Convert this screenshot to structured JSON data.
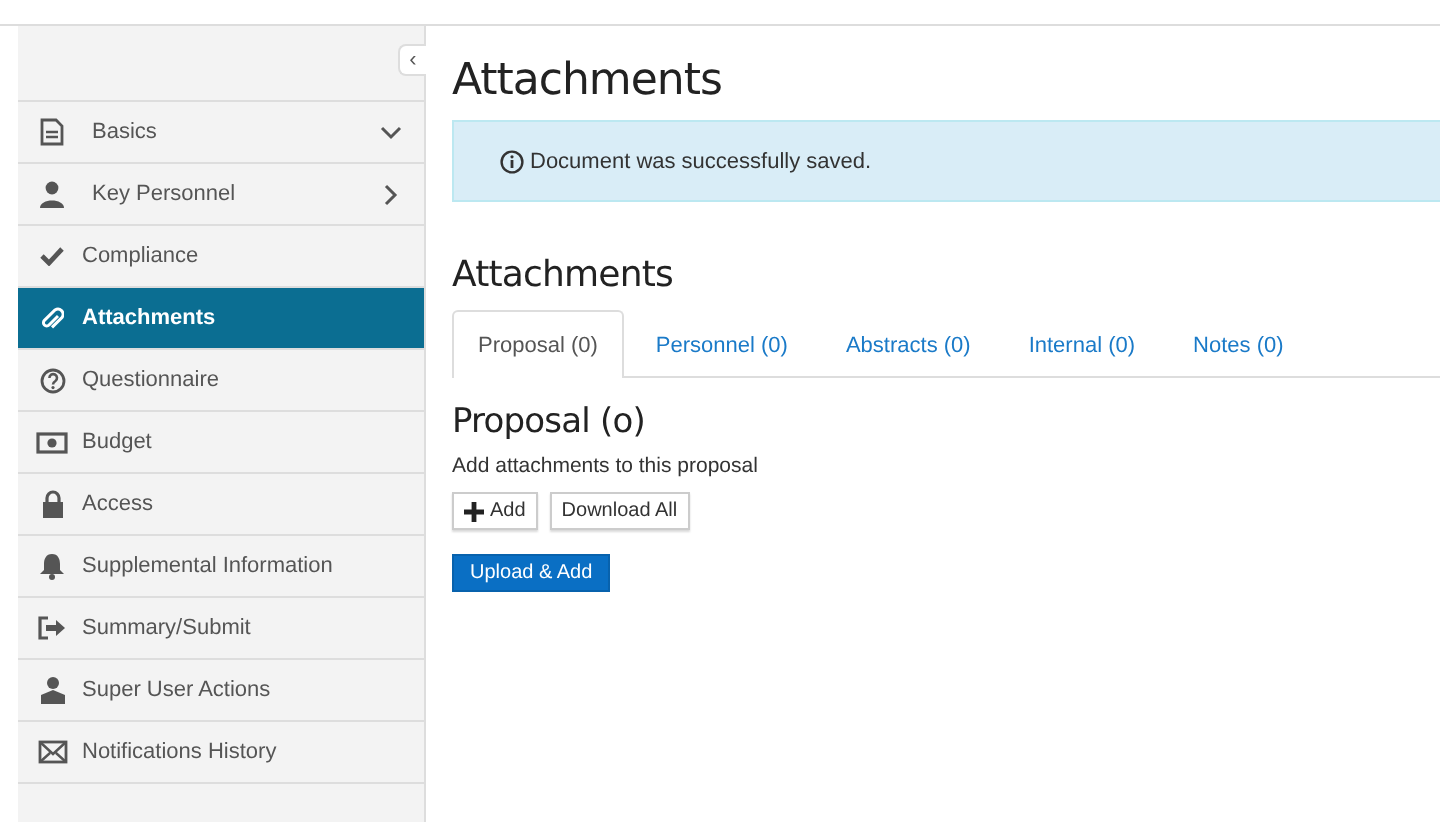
{
  "sidebar": {
    "collapse_button": "‹",
    "items": [
      {
        "label": "Basics",
        "kind": "group",
        "expanded": true,
        "selected": false
      },
      {
        "label": "Key Personnel",
        "kind": "group",
        "expanded": false,
        "selected": false
      },
      {
        "label": "Compliance",
        "kind": "link",
        "selected": false
      },
      {
        "label": "Attachments",
        "kind": "link",
        "selected": true
      },
      {
        "label": "Questionnaire",
        "kind": "link",
        "selected": false
      },
      {
        "label": "Budget",
        "kind": "link",
        "selected": false
      },
      {
        "label": "Access",
        "kind": "link",
        "selected": false
      },
      {
        "label": "Supplemental Information",
        "kind": "link",
        "selected": false
      },
      {
        "label": "Summary/Submit",
        "kind": "link",
        "selected": false
      },
      {
        "label": "Super User Actions",
        "kind": "link",
        "selected": false
      },
      {
        "label": "Notifications History",
        "kind": "link",
        "selected": false
      }
    ]
  },
  "main": {
    "title": "Attachments",
    "alert": "Document was successfully saved.",
    "section_title": "Attachments",
    "tabs": [
      {
        "label": "Proposal (0)",
        "selected": true
      },
      {
        "label": "Personnel (0)",
        "selected": false
      },
      {
        "label": "Abstracts (0)",
        "selected": false
      },
      {
        "label": "Internal (0)",
        "selected": false
      },
      {
        "label": "Notes (0)",
        "selected": false
      }
    ],
    "panel": {
      "title": "Proposal (o)",
      "description": "Add attachments to this proposal",
      "add_button": "Add",
      "download_button": "Download All",
      "upload_button": "Upload & Add"
    }
  }
}
